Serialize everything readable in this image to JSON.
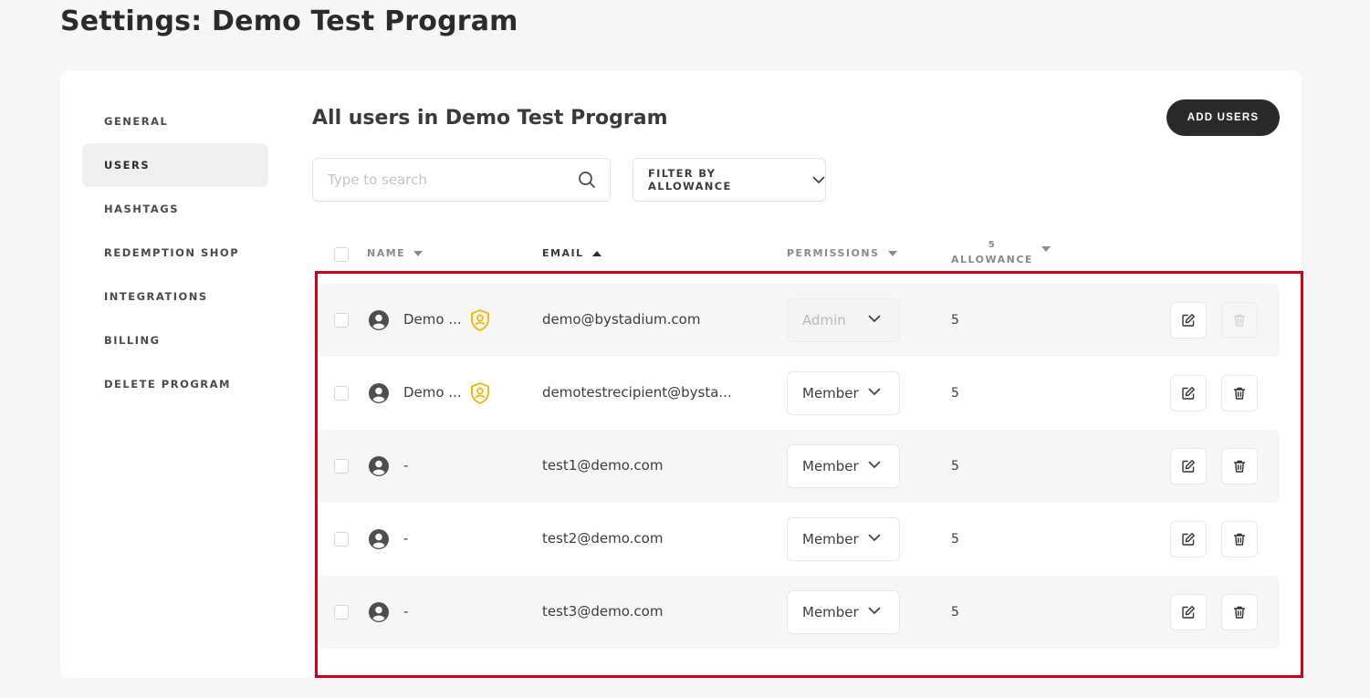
{
  "page": {
    "title": "Settings: Demo Test Program"
  },
  "colors": {
    "highlight": "#d1001c",
    "admin_badge": "#f2b90c",
    "primary_button": "#2a2a2a"
  },
  "sidebar": {
    "items": [
      {
        "label": "GENERAL",
        "active": false
      },
      {
        "label": "USERS",
        "active": true
      },
      {
        "label": "HASHTAGS",
        "active": false
      },
      {
        "label": "REDEMPTION SHOP",
        "active": false
      },
      {
        "label": "INTEGRATIONS",
        "active": false
      },
      {
        "label": "BILLING",
        "active": false
      },
      {
        "label": "DELETE PROGRAM",
        "active": false
      }
    ]
  },
  "main": {
    "title": "All users in Demo Test Program",
    "add_users_label": "ADD USERS",
    "search": {
      "placeholder": "Type to search",
      "value": "",
      "icon": "search-icon"
    },
    "filter_label": "FILTER BY ALLOWANCE"
  },
  "table": {
    "columns": {
      "name": "NAME",
      "email": "EMAIL",
      "permissions": "PERMISSIONS",
      "allowance_top": "5",
      "allowance": "ALLOWANCE"
    },
    "sorted_by": "EMAIL",
    "sort_direction": "ascending",
    "rows": [
      {
        "name": "Demo ...",
        "is_admin": true,
        "email": "demo@bystadium.com",
        "permission": "Admin",
        "permission_disabled": true,
        "allowance": "5",
        "delete_disabled": true
      },
      {
        "name": "Demo ...",
        "is_admin": true,
        "email": "demotestrecipient@bysta...",
        "permission": "Member",
        "permission_disabled": false,
        "allowance": "5",
        "delete_disabled": false
      },
      {
        "name": "-",
        "is_admin": false,
        "email": "test1@demo.com",
        "permission": "Member",
        "permission_disabled": false,
        "allowance": "5",
        "delete_disabled": false
      },
      {
        "name": "-",
        "is_admin": false,
        "email": "test2@demo.com",
        "permission": "Member",
        "permission_disabled": false,
        "allowance": "5",
        "delete_disabled": false
      },
      {
        "name": "-",
        "is_admin": false,
        "email": "test3@demo.com",
        "permission": "Member",
        "permission_disabled": false,
        "allowance": "5",
        "delete_disabled": false
      }
    ]
  }
}
